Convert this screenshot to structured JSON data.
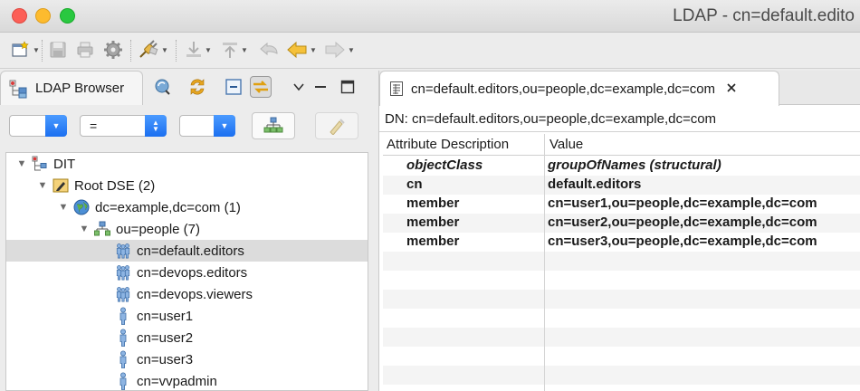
{
  "window": {
    "title": "LDAP - cn=default.edito"
  },
  "left_panel": {
    "tab_label": "LDAP Browser",
    "filter": {
      "attribute_value": "",
      "operator_value": "=",
      "value_value": ""
    },
    "tree": [
      {
        "label": "DIT",
        "level": 0,
        "expanded": true,
        "icon": "dit-icon"
      },
      {
        "label": "Root DSE (2)",
        "level": 1,
        "expanded": true,
        "icon": "root-dse-icon"
      },
      {
        "label": "dc=example,dc=com (1)",
        "level": 2,
        "expanded": true,
        "icon": "globe-icon"
      },
      {
        "label": "ou=people (7)",
        "level": 3,
        "expanded": true,
        "icon": "org-unit-icon"
      },
      {
        "label": "cn=default.editors",
        "level": 4,
        "icon": "group-icon",
        "selected": true
      },
      {
        "label": "cn=devops.editors",
        "level": 4,
        "icon": "group-icon"
      },
      {
        "label": "cn=devops.viewers",
        "level": 4,
        "icon": "group-icon"
      },
      {
        "label": "cn=user1",
        "level": 4,
        "icon": "person-icon"
      },
      {
        "label": "cn=user2",
        "level": 4,
        "icon": "person-icon"
      },
      {
        "label": "cn=user3",
        "level": 4,
        "icon": "person-icon"
      },
      {
        "label": "cn=vvpadmin",
        "level": 4,
        "icon": "person-icon"
      }
    ]
  },
  "editor": {
    "tab_label": "cn=default.editors,ou=people,dc=example,dc=com",
    "dn_line": "DN: cn=default.editors,ou=people,dc=example,dc=com",
    "columns": [
      "Attribute Description",
      "Value"
    ],
    "rows": [
      {
        "attr": "objectClass",
        "value": "groupOfNames (structural)",
        "italic": true
      },
      {
        "attr": "cn",
        "value": "default.editors"
      },
      {
        "attr": "member",
        "value": "cn=user1,ou=people,dc=example,dc=com"
      },
      {
        "attr": "member",
        "value": "cn=user2,ou=people,dc=example,dc=com"
      },
      {
        "attr": "member",
        "value": "cn=user3,ou=people,dc=example,dc=com"
      }
    ]
  }
}
